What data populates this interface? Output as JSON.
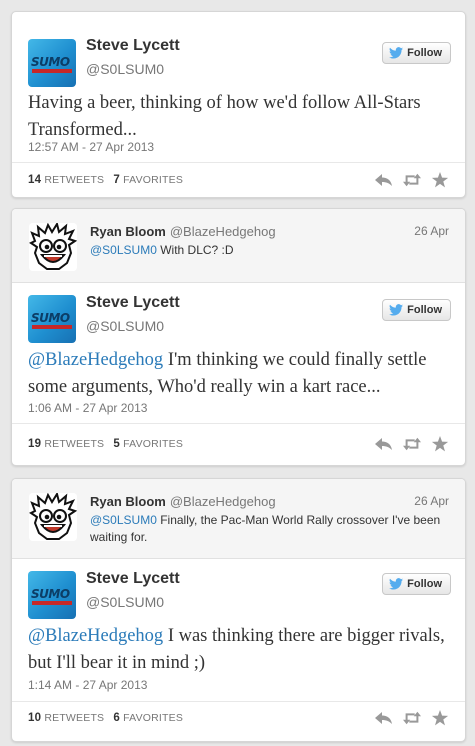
{
  "colors": {
    "mention": "#2b7bb9",
    "twitter_blue": "#55acee",
    "sumo_blue": "#2a9ad8"
  },
  "icons": {
    "reply": "reply-icon",
    "retweet": "retweet-icon",
    "favorite": "star-icon",
    "follow": "twitter-bird-icon"
  },
  "follow_label": "Follow",
  "retweets_label": "RETWEETS",
  "favorites_label": "FAVORITES",
  "tweets": [
    {
      "author": "Steve Lycett",
      "handle": "@S0LSUM0",
      "body": "Having a beer, thinking of how we'd follow All-Stars Transformed...",
      "timestamp": "12:57 AM - 27 Apr 2013",
      "retweets": "14",
      "favorites": "7"
    },
    {
      "reply": {
        "author": "Ryan Bloom",
        "handle": "@BlazeHedgehog",
        "date": "26 Apr",
        "mention": "@S0LSUM0",
        "text": " With DLC? :D"
      },
      "author": "Steve Lycett",
      "handle": "@S0LSUM0",
      "mention": "@BlazeHedgehog",
      "body": " I'm thinking we could finally settle some arguments, Who'd really win a kart race...",
      "timestamp": "1:06 AM - 27 Apr 2013",
      "retweets": "19",
      "favorites": "5"
    },
    {
      "reply": {
        "author": "Ryan Bloom",
        "handle": "@BlazeHedgehog",
        "date": "26 Apr",
        "mention": "@S0LSUM0",
        "text": " Finally, the Pac-Man World Rally crossover I've been waiting for."
      },
      "author": "Steve Lycett",
      "handle": "@S0LSUM0",
      "mention": "@BlazeHedgehog",
      "body": " I was thinking there are bigger rivals, but I'll bear it in mind ;)",
      "timestamp": "1:14 AM - 27 Apr 2013",
      "retweets": "10",
      "favorites": "6"
    }
  ]
}
